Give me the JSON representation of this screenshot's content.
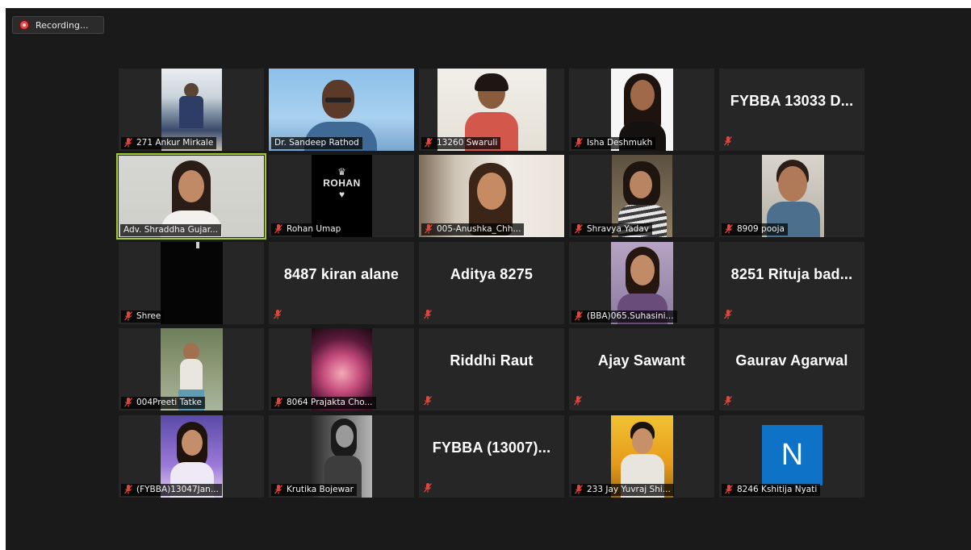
{
  "recording": {
    "label": "Recording..."
  },
  "participants": [
    {
      "name": "271 Ankur Mirkale",
      "type": "photo",
      "muted": true
    },
    {
      "name": "Dr. Sandeep Rathod",
      "type": "video",
      "muted": false
    },
    {
      "name": "13260 Swaruli",
      "type": "photo",
      "muted": true
    },
    {
      "name": "Isha Deshmukh",
      "type": "photo",
      "muted": true
    },
    {
      "name": "FYBBA 13033 D...",
      "type": "text",
      "muted": true
    },
    {
      "name": "Adv. Shraddha Gujar...",
      "type": "video",
      "muted": false,
      "active": true
    },
    {
      "name": "Rohan Umap",
      "type": "logo",
      "logo_text": "ROHAN",
      "muted": true
    },
    {
      "name": "005-Anushka_Chh...",
      "type": "video",
      "muted": true
    },
    {
      "name": "Shravya Yadav",
      "type": "photo",
      "muted": true
    },
    {
      "name": "8909 pooja",
      "type": "photo",
      "muted": true
    },
    {
      "name": "Shree",
      "type": "photo",
      "muted": true
    },
    {
      "name": "8487 kiran alane",
      "type": "text",
      "muted": true
    },
    {
      "name": "Aditya 8275",
      "type": "text",
      "muted": true
    },
    {
      "name": "(BBA)065.Suhasini...",
      "type": "photo",
      "muted": true
    },
    {
      "name": "8251 Rituja bad...",
      "type": "text",
      "muted": true
    },
    {
      "name": "004Preeti Tatke",
      "type": "photo",
      "muted": true
    },
    {
      "name": "8064 Prajakta Cho...",
      "type": "photo",
      "muted": true
    },
    {
      "name": "Riddhi Raut",
      "type": "text",
      "muted": true
    },
    {
      "name": "Ajay Sawant",
      "type": "text",
      "muted": true
    },
    {
      "name": "Gaurav Agarwal",
      "type": "text",
      "muted": true
    },
    {
      "name": "(FYBBA)13047Jan...",
      "type": "photo",
      "muted": true
    },
    {
      "name": "Krutika Bojewar",
      "type": "photo",
      "muted": true
    },
    {
      "name": "FYBBA (13007)...",
      "type": "text",
      "muted": true
    },
    {
      "name": "233 Jay Yuvraj Shi...",
      "type": "photo",
      "muted": true
    },
    {
      "name": "8246 Kshitija Nyati",
      "type": "avatar",
      "initial": "N",
      "muted": true
    }
  ],
  "colors": {
    "background": "#1a1a1a",
    "tile": "#262626",
    "active_border": "#9ecb34",
    "mute_red": "#e0463c",
    "avatar_blue": "#0e72c6"
  }
}
